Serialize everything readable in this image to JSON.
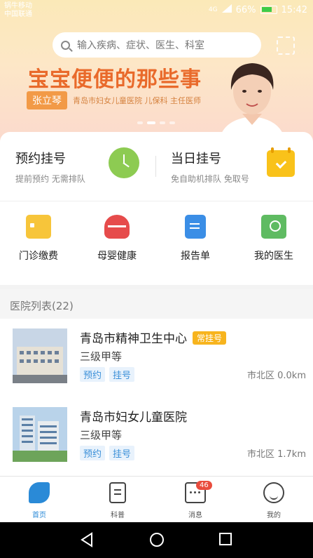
{
  "status_bar": {
    "carrier_line1": "锅牛移动",
    "carrier_line2": "中国联通",
    "network": "4G",
    "battery": "66%",
    "time": "15:42"
  },
  "search": {
    "placeholder": "输入疾病、症状、医生、科室"
  },
  "banner": {
    "headline": "宝宝便便的那些事",
    "doctor_name": "张立琴",
    "doctor_info": "青岛市妇女儿童医院 儿保科 主任医师"
  },
  "registration": {
    "appointment": {
      "title": "预约挂号",
      "subtitle": "提前预约 无需排队"
    },
    "same_day": {
      "title": "当日挂号",
      "subtitle": "免自助机排队 免取号"
    }
  },
  "quick_actions": [
    {
      "label": "门诊缴费",
      "icon": "payment-card-icon"
    },
    {
      "label": "母婴健康",
      "icon": "heart-pulse-icon"
    },
    {
      "label": "报告单",
      "icon": "report-doc-icon"
    },
    {
      "label": "我的医生",
      "icon": "doctor-icon"
    }
  ],
  "hospital_list": {
    "header": "医院列表(22)",
    "items": [
      {
        "name": "青岛市精神卫生中心",
        "badge": "常挂号",
        "level": "三级甲等",
        "tags": [
          "预约",
          "挂号"
        ],
        "distance": "市北区 0.0km"
      },
      {
        "name": "青岛市妇女儿童医院",
        "badge": "",
        "level": "三级甲等",
        "tags": [
          "预约",
          "挂号"
        ],
        "distance": "市北区 1.7km"
      }
    ]
  },
  "tabs": [
    {
      "label": "首页",
      "icon": "home-bird-icon",
      "active": true
    },
    {
      "label": "科普",
      "icon": "article-icon",
      "active": false
    },
    {
      "label": "消息",
      "icon": "message-icon",
      "active": false,
      "badge": "46"
    },
    {
      "label": "我的",
      "icon": "smiley-icon",
      "active": false
    }
  ],
  "colors": {
    "primary": "#2a8ad7",
    "banner_orange": "#e96a2b",
    "badge_yellow": "#f7b41e",
    "clock_green": "#8dcb52",
    "calendar_yellow": "#f9c21a"
  }
}
